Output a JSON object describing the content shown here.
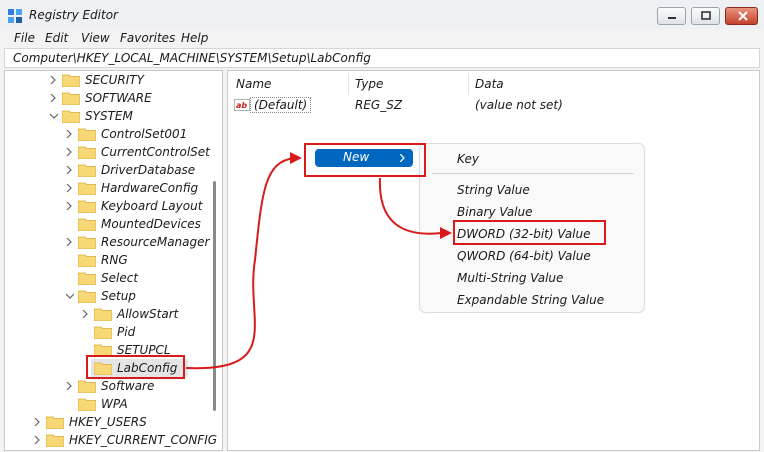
{
  "window": {
    "title": "Registry Editor"
  },
  "menubar": [
    "File",
    "Edit",
    "View",
    "Favorites",
    "Help"
  ],
  "address": "Computer\\HKEY_LOCAL_MACHINE\\SYSTEM\\Setup\\LabConfig",
  "tree": [
    "SECURITY",
    "SOFTWARE",
    "SYSTEM",
    "ControlSet001",
    "CurrentControlSet",
    "DriverDatabase",
    "HardwareConfig",
    "Keyboard Layout",
    "MountedDevices",
    "ResourceManager",
    "RNG",
    "Select",
    "Setup",
    "AllowStart",
    "Pid",
    "SETUPCL",
    "LabConfig",
    "Software",
    "WPA",
    "HKEY_USERS",
    "HKEY_CURRENT_CONFIG"
  ],
  "list": {
    "headers": {
      "name": "Name",
      "type": "Type",
      "data": "Data"
    },
    "rows": [
      {
        "name": "(Default)",
        "type": "REG_SZ",
        "data": "(value not set)"
      }
    ]
  },
  "context_menu": {
    "new": "New"
  },
  "submenu": [
    "Key",
    "String Value",
    "Binary Value",
    "DWORD (32-bit) Value",
    "QWORD (64-bit) Value",
    "Multi-String Value",
    "Expandable String Value"
  ],
  "colors": {
    "accent": "#0067c0",
    "highlight": "#d91a1a",
    "folder": "#f8d775"
  }
}
